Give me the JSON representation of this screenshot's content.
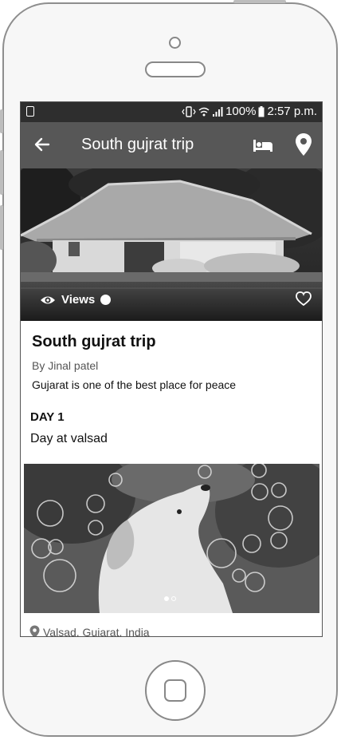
{
  "status_bar": {
    "battery": "100%",
    "time": "2:57 p.m."
  },
  "app_bar": {
    "title": "South gujrat trip"
  },
  "hero": {
    "views_label": "Views"
  },
  "trip": {
    "title": "South gujrat trip",
    "author": "By Jinal patel",
    "description": "Gujarat is one of the best place for peace"
  },
  "day": {
    "label": "DAY 1",
    "title": "Day at valsad"
  },
  "gallery": {
    "pages": 2,
    "current_page": 1
  },
  "location": {
    "text": "Valsad, Gujarat, India"
  },
  "colors": {
    "app_bar": "#575757",
    "status_bar": "#2e2e2e"
  }
}
